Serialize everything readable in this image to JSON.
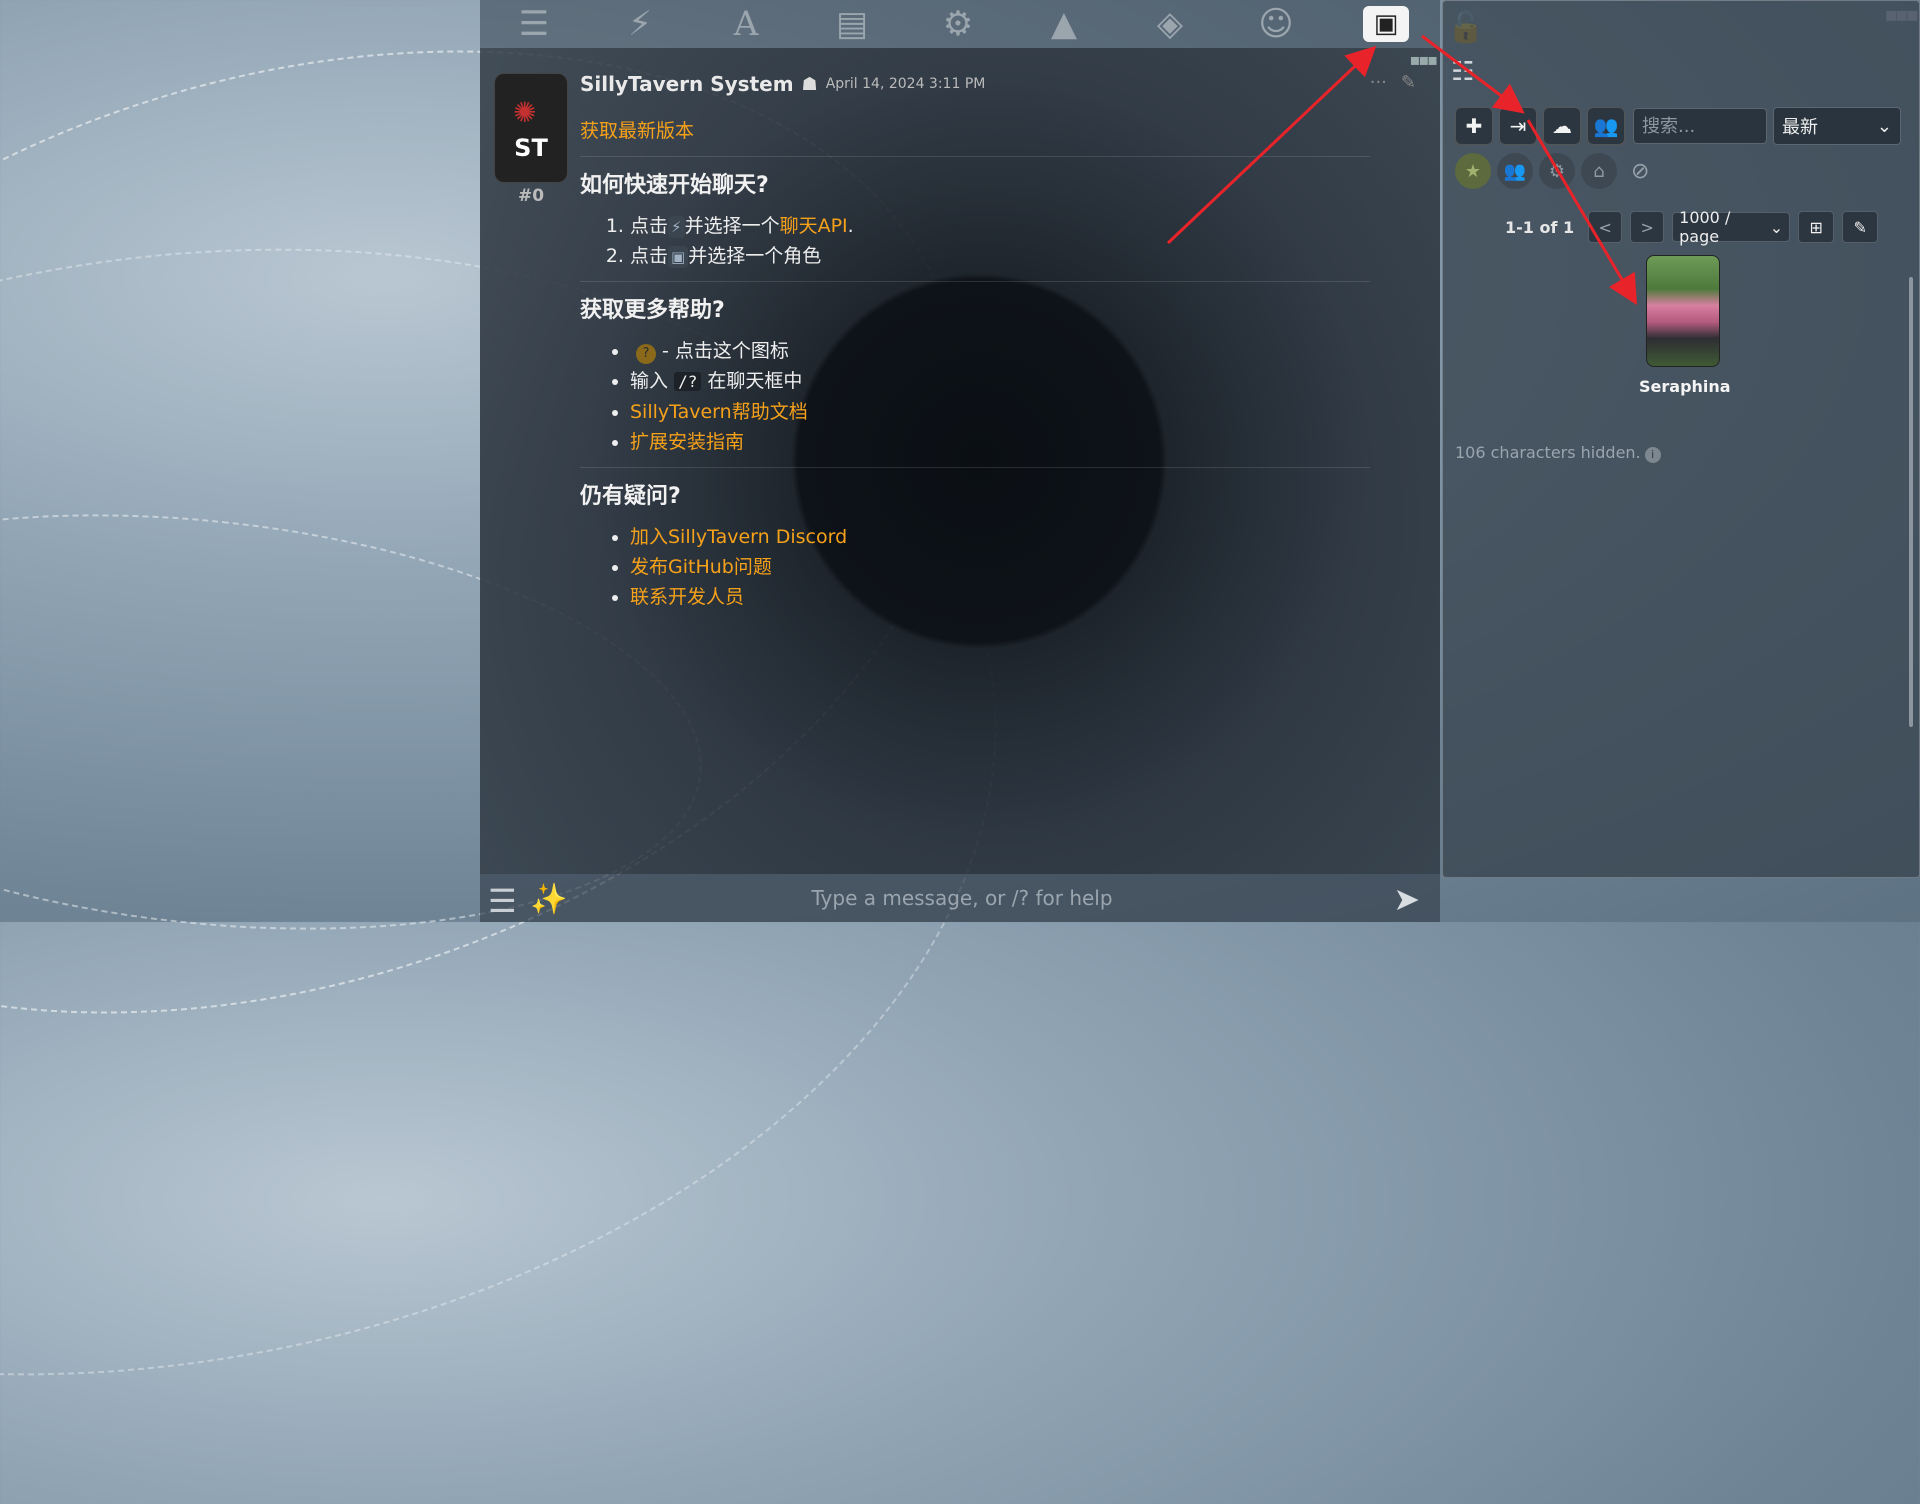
{
  "nav": {
    "items": [
      {
        "icon": "sliders-icon",
        "glyph": "☰"
      },
      {
        "icon": "plug-icon",
        "glyph": "⚡"
      },
      {
        "icon": "font-icon",
        "glyph": "A"
      },
      {
        "icon": "book-icon",
        "glyph": "▤"
      },
      {
        "icon": "user-gear-icon",
        "glyph": "⚙"
      },
      {
        "icon": "image-icon",
        "glyph": "▲"
      },
      {
        "icon": "cubes-icon",
        "glyph": "◈"
      },
      {
        "icon": "smiley-icon",
        "glyph": "☺"
      },
      {
        "icon": "character-card-icon",
        "glyph": "▣"
      }
    ]
  },
  "message": {
    "sender": "SillyTavern System",
    "timestamp": "April 14, 2024 3:11 PM",
    "index": "#0",
    "avatar_text": "ST",
    "latest_link": "获取最新版本",
    "quickstart_title": "如何快速开始聊天?",
    "step1_prefix": "点击",
    "step1_middle": "并选择一个",
    "step1_link": "聊天API",
    "step1_suffix": ".",
    "step2_prefix": "点击",
    "step2_suffix": "并选择一个角色",
    "help_title": "获取更多帮助?",
    "help_icon_text": "- 点击这个图标",
    "help_cmd_prefix": "输入",
    "help_cmd": "/?",
    "help_cmd_suffix": "在聊天框中",
    "help_docs_link": "SillyTavern帮助文档",
    "help_ext_link": "扩展安装指南",
    "questions_title": "仍有疑问?",
    "q_discord": "加入SillyTavern Discord",
    "q_github": "发布GitHub问题",
    "q_contact": "联系开发人员"
  },
  "input": {
    "placeholder": "Type a message, or /? for help"
  },
  "right_panel": {
    "search_placeholder": "搜索...",
    "sort_value": "最新",
    "page_info": "1-1 of 1",
    "prev": "<",
    "next": ">",
    "per_page": "1000 / page",
    "character_name": "Seraphina",
    "hidden_note": "106 characters hidden."
  },
  "colors": {
    "link": "#f6a11a",
    "arrow": "#e8232a"
  }
}
